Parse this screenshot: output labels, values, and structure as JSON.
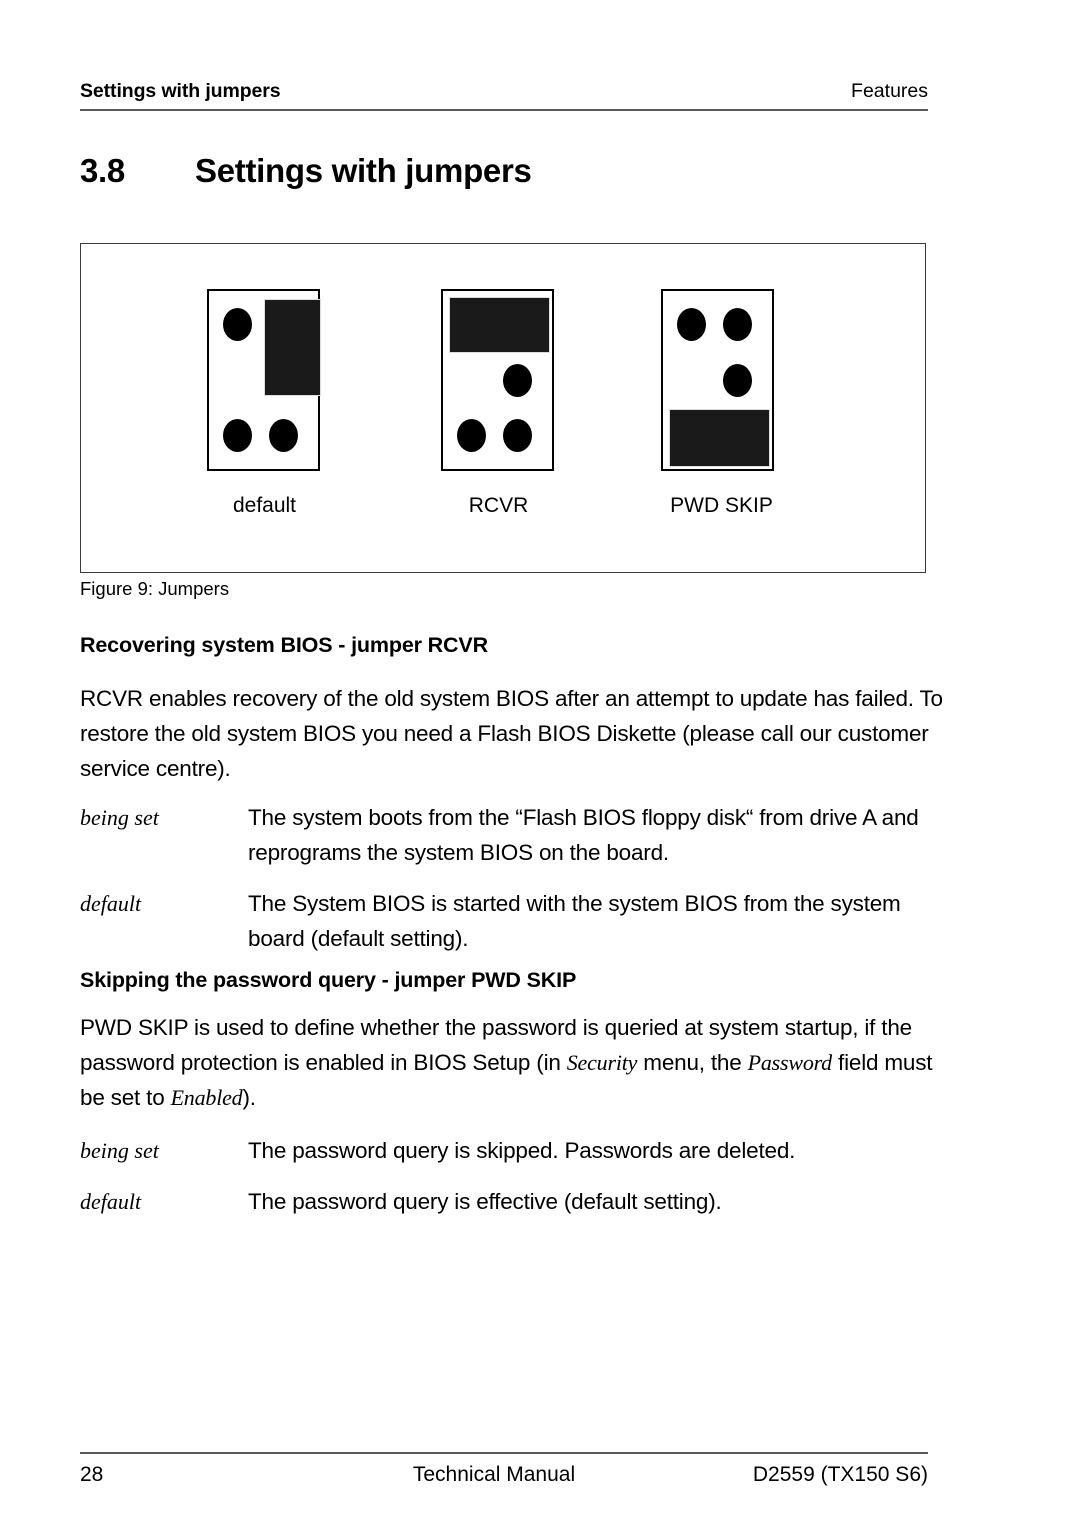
{
  "header": {
    "left_title": "Settings with jumpers",
    "right_title": "Features"
  },
  "section": {
    "number": "3.8",
    "title": "Settings with jumpers"
  },
  "figure": {
    "caption": "Figure 9: Jumpers",
    "jumpers": [
      {
        "label": "default",
        "cap_position": "vertical-right-column-top"
      },
      {
        "label": "RCVR",
        "cap_position": "horizontal-top-row"
      },
      {
        "label": "PWD SKIP",
        "cap_position": "horizontal-bottom-row"
      }
    ]
  },
  "rcvr_section": {
    "heading": "Recovering system BIOS - jumper RCVR",
    "paragraph": "RCVR enables recovery of the old system BIOS after an attempt to update has failed. To restore the old system BIOS you need a Flash BIOS Diskette (please call our customer service centre).",
    "definitions": [
      {
        "term": "being set",
        "description": "The system boots from the “Flash BIOS floppy disk“ from drive A and reprograms the system BIOS on the board."
      },
      {
        "term": "default",
        "description": "The System BIOS is started with the system BIOS from the system board (default setting)."
      }
    ]
  },
  "pwd_section": {
    "heading": "Skipping the password query - jumper PWD SKIP",
    "paragraph_part1": "PWD SKIP is used to define whether the password is queried at system startup, if the password protection is enabled in BIOS Setup (in ",
    "paragraph_italic1": "Security",
    "paragraph_part2": " menu, the ",
    "paragraph_italic2": "Password",
    "paragraph_part3": " field must be set to ",
    "paragraph_italic3": "Enabled",
    "paragraph_part4": ").",
    "definitions": [
      {
        "term": "being set",
        "description": "The password query is skipped. Passwords are deleted."
      },
      {
        "term": "default",
        "description": "The password query is effective (default setting)."
      }
    ]
  },
  "footer": {
    "page_number": "28",
    "document_title": "Technical Manual",
    "document_id": "D2559 (TX150 S6)"
  }
}
